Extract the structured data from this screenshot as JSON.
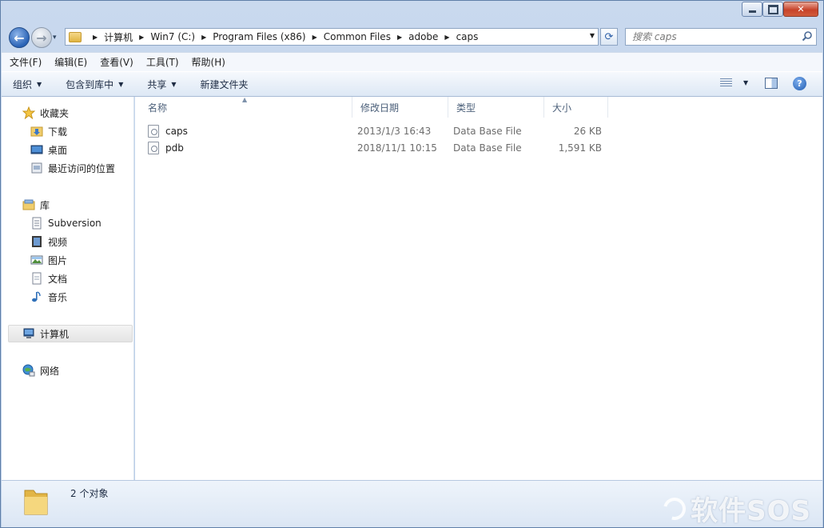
{
  "window": {
    "minimize_icon": "minimize-icon",
    "maximize_icon": "maximize-icon",
    "close_glyph": "✕"
  },
  "navigation": {
    "back_glyph": "←",
    "forward_glyph": "→",
    "history_glyph": "▾",
    "refresh_glyph": "⟳",
    "breadcrumbs": [
      "计算机",
      "Win7 (C:)",
      "Program Files (x86)",
      "Common Files",
      "adobe",
      "caps"
    ],
    "search_placeholder": "搜索 caps"
  },
  "menu": {
    "items": [
      "文件(F)",
      "编辑(E)",
      "查看(V)",
      "工具(T)",
      "帮助(H)"
    ]
  },
  "commands": {
    "organize": "组织",
    "include_library": "包含到库中",
    "share": "共享",
    "new_folder": "新建文件夹",
    "help_glyph": "?"
  },
  "sidebar": {
    "favorites": {
      "label": "收藏夹",
      "items": [
        "下载",
        "桌面",
        "最近访问的位置"
      ]
    },
    "libraries": {
      "label": "库",
      "items": [
        "Subversion",
        "视频",
        "图片",
        "文档",
        "音乐"
      ]
    },
    "computer": {
      "label": "计算机"
    },
    "network": {
      "label": "网络"
    }
  },
  "files": {
    "columns": [
      "名称",
      "修改日期",
      "类型",
      "大小"
    ],
    "rows": [
      {
        "name": "caps",
        "modified": "2013/1/3 16:43",
        "type": "Data Base File",
        "size": "26 KB"
      },
      {
        "name": "pdb",
        "modified": "2018/11/1 10:15",
        "type": "Data Base File",
        "size": "1,591 KB"
      }
    ]
  },
  "details": {
    "count": "2 个对象"
  },
  "watermark": "软件SOS"
}
